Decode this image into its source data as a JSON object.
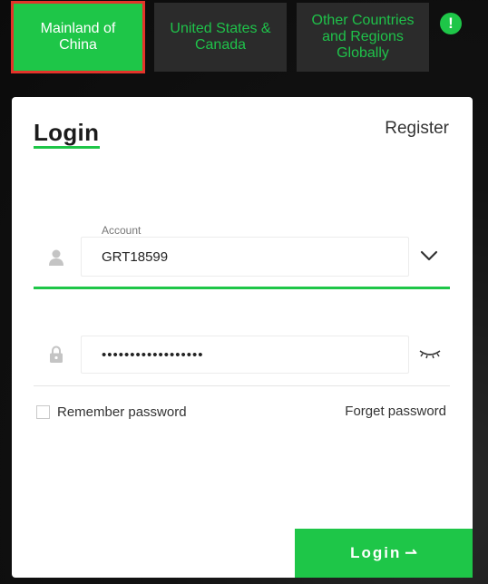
{
  "regions": {
    "mainland": "Mainland of China",
    "us_canada": "United States & Canada",
    "other": "Other Countries and Regions Globally"
  },
  "notice": {
    "symbol": "!"
  },
  "login_form": {
    "title": "Login",
    "register": "Register",
    "account_label": "Account",
    "account_value": "GRT18599",
    "password_value": "••••••••••••••••••",
    "remember": "Remember password",
    "forget": "Forget password",
    "login_button": "Login",
    "login_arrow": "⇀"
  },
  "colors": {
    "accent": "#1ec648",
    "active_outline": "#e3342a",
    "tab_bg": "#2b2b2b"
  },
  "icons": {
    "account": "user-icon",
    "password": "lock-icon",
    "dropdown": "chevron-down-icon",
    "visibility": "eye-closed-icon",
    "notice": "exclamation-icon"
  }
}
